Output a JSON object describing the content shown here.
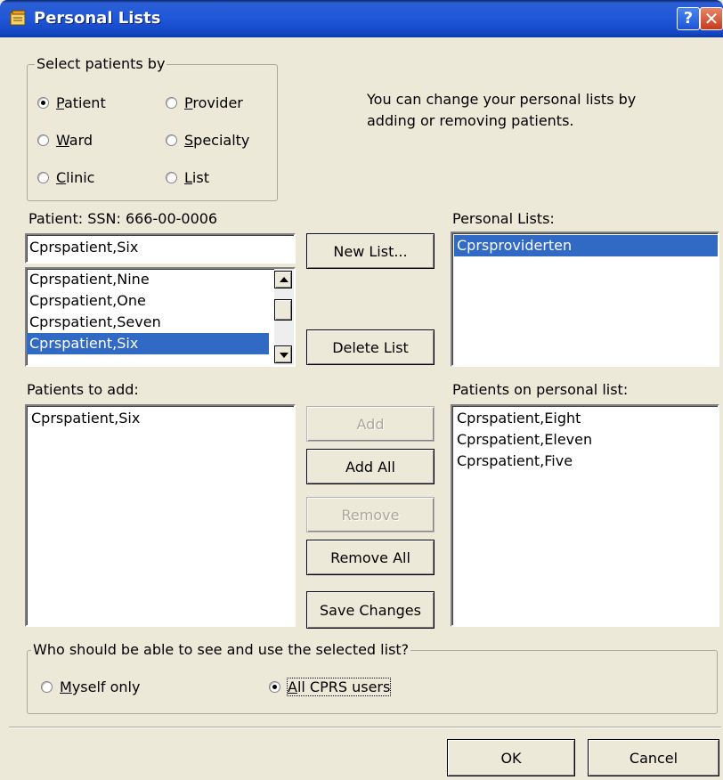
{
  "window": {
    "title": "Personal Lists",
    "help_glyph": "?",
    "close_glyph": "✕"
  },
  "select_by": {
    "title": "Select patients by",
    "options": [
      {
        "pre": "",
        "ul": "P",
        "post": "",
        "rest": "atient",
        "checked": true
      },
      {
        "pre": "",
        "ul": "P",
        "rest": "rovider",
        "checked": false
      },
      {
        "pre": "",
        "ul": "W",
        "rest": "ard",
        "checked": false
      },
      {
        "pre": "",
        "ul": "S",
        "rest": "pecialty",
        "checked": false
      },
      {
        "pre": "",
        "ul": "C",
        "rest": "linic",
        "checked": false
      },
      {
        "pre": "",
        "ul": "L",
        "rest": "ist",
        "checked": false
      }
    ]
  },
  "info_text": {
    "line1": "You can change your personal lists by",
    "line2": "adding or removing patients."
  },
  "patient": {
    "label": "Patient:  SSN: 666-00-0006",
    "search_value": "Cprspatient,Six",
    "list": [
      "Cprspatient,Nine",
      "Cprspatient,One",
      "Cprspatient,Seven",
      "Cprspatient,Six"
    ],
    "selected_index": 3
  },
  "personal_lists": {
    "label": "Personal Lists:",
    "items": [
      "Cprsproviderten"
    ],
    "selected_index": 0
  },
  "buttons": {
    "new_list": "New List...",
    "delete_list": "Delete List",
    "add": "Add",
    "add_all": "Add All",
    "remove": "Remove",
    "remove_all": "Remove All",
    "save_changes": "Save Changes",
    "ok": "OK",
    "cancel": "Cancel"
  },
  "patients_to_add": {
    "label": "Patients to add:",
    "items": [
      "Cprspatient,Six"
    ]
  },
  "patients_on_list": {
    "label": "Patients on personal list:",
    "items": [
      "Cprspatient,Eight",
      "Cprspatient,Eleven",
      "Cprspatient,Five"
    ]
  },
  "visibility": {
    "title": "Who should be able to see and use the selected  list?",
    "myself": {
      "ul": "M",
      "rest": "yself only",
      "checked": false
    },
    "all": {
      "ul": "A",
      "rest": "ll CPRS users",
      "checked": true
    }
  },
  "colors": {
    "titlebar": "#1e57d8",
    "selection": "#316ac5",
    "face": "#ece9d8"
  }
}
